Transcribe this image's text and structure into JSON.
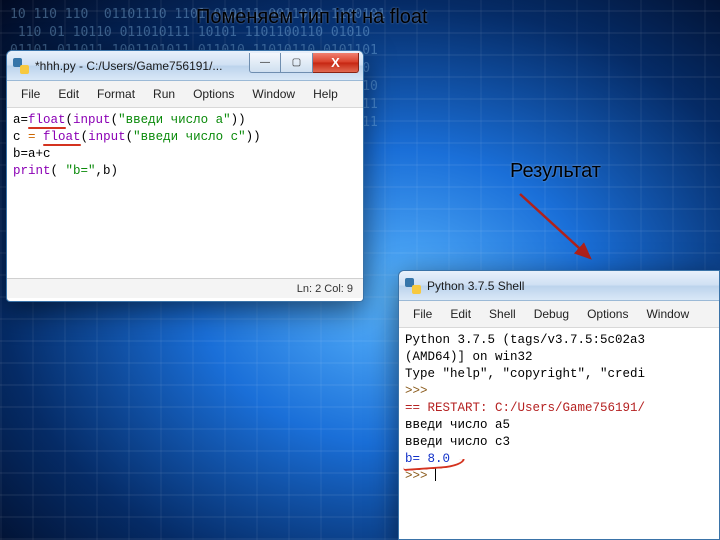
{
  "annotations": {
    "change_type": "Поменяем тип int на float",
    "result_label": "Результат"
  },
  "editor_window": {
    "title": "*hhh.py - C:/Users/Game756191/...",
    "menubar": [
      "File",
      "Edit",
      "Format",
      "Run",
      "Options",
      "Window",
      "Help"
    ],
    "code": {
      "l1_a": "a=",
      "l1_float": "float",
      "l1_p1": "(",
      "l1_input": "input",
      "l1_p2": "(",
      "l1_s": "\"введи число a\"",
      "l1_p3": "))",
      "l2_a": "c ",
      "l2_eq": "=",
      "l2_sp": " ",
      "l2_float": "float",
      "l2_p1": "(",
      "l2_input": "input",
      "l2_p2": "(",
      "l2_s": "\"введи число c\"",
      "l2_p3": "))",
      "l3": "b=a+c",
      "l4_print": "print",
      "l4_p1": "( ",
      "l4_s": "\"b=\"",
      "l4_rest": ",b)"
    },
    "status": "Ln: 2  Col: 9"
  },
  "shell_window": {
    "title": "Python 3.7.5 Shell",
    "menubar": [
      "File",
      "Edit",
      "Shell",
      "Debug",
      "Options",
      "Window"
    ],
    "lines": {
      "banner1": "Python 3.7.5 (tags/v3.7.5:5c02a3",
      "banner2": "(AMD64)] on win32",
      "banner3": "Type \"help\", \"copyright\", \"credi",
      "prompt1": ">>> ",
      "restart": "== RESTART: C:/Users/Game756191/",
      "in_a": "введи число a5",
      "in_c": "введи число c3",
      "out_b": "b= 8.0",
      "prompt2": ">>> "
    }
  },
  "win_buttons": {
    "min": "—",
    "max": "▢",
    "close": "X"
  }
}
